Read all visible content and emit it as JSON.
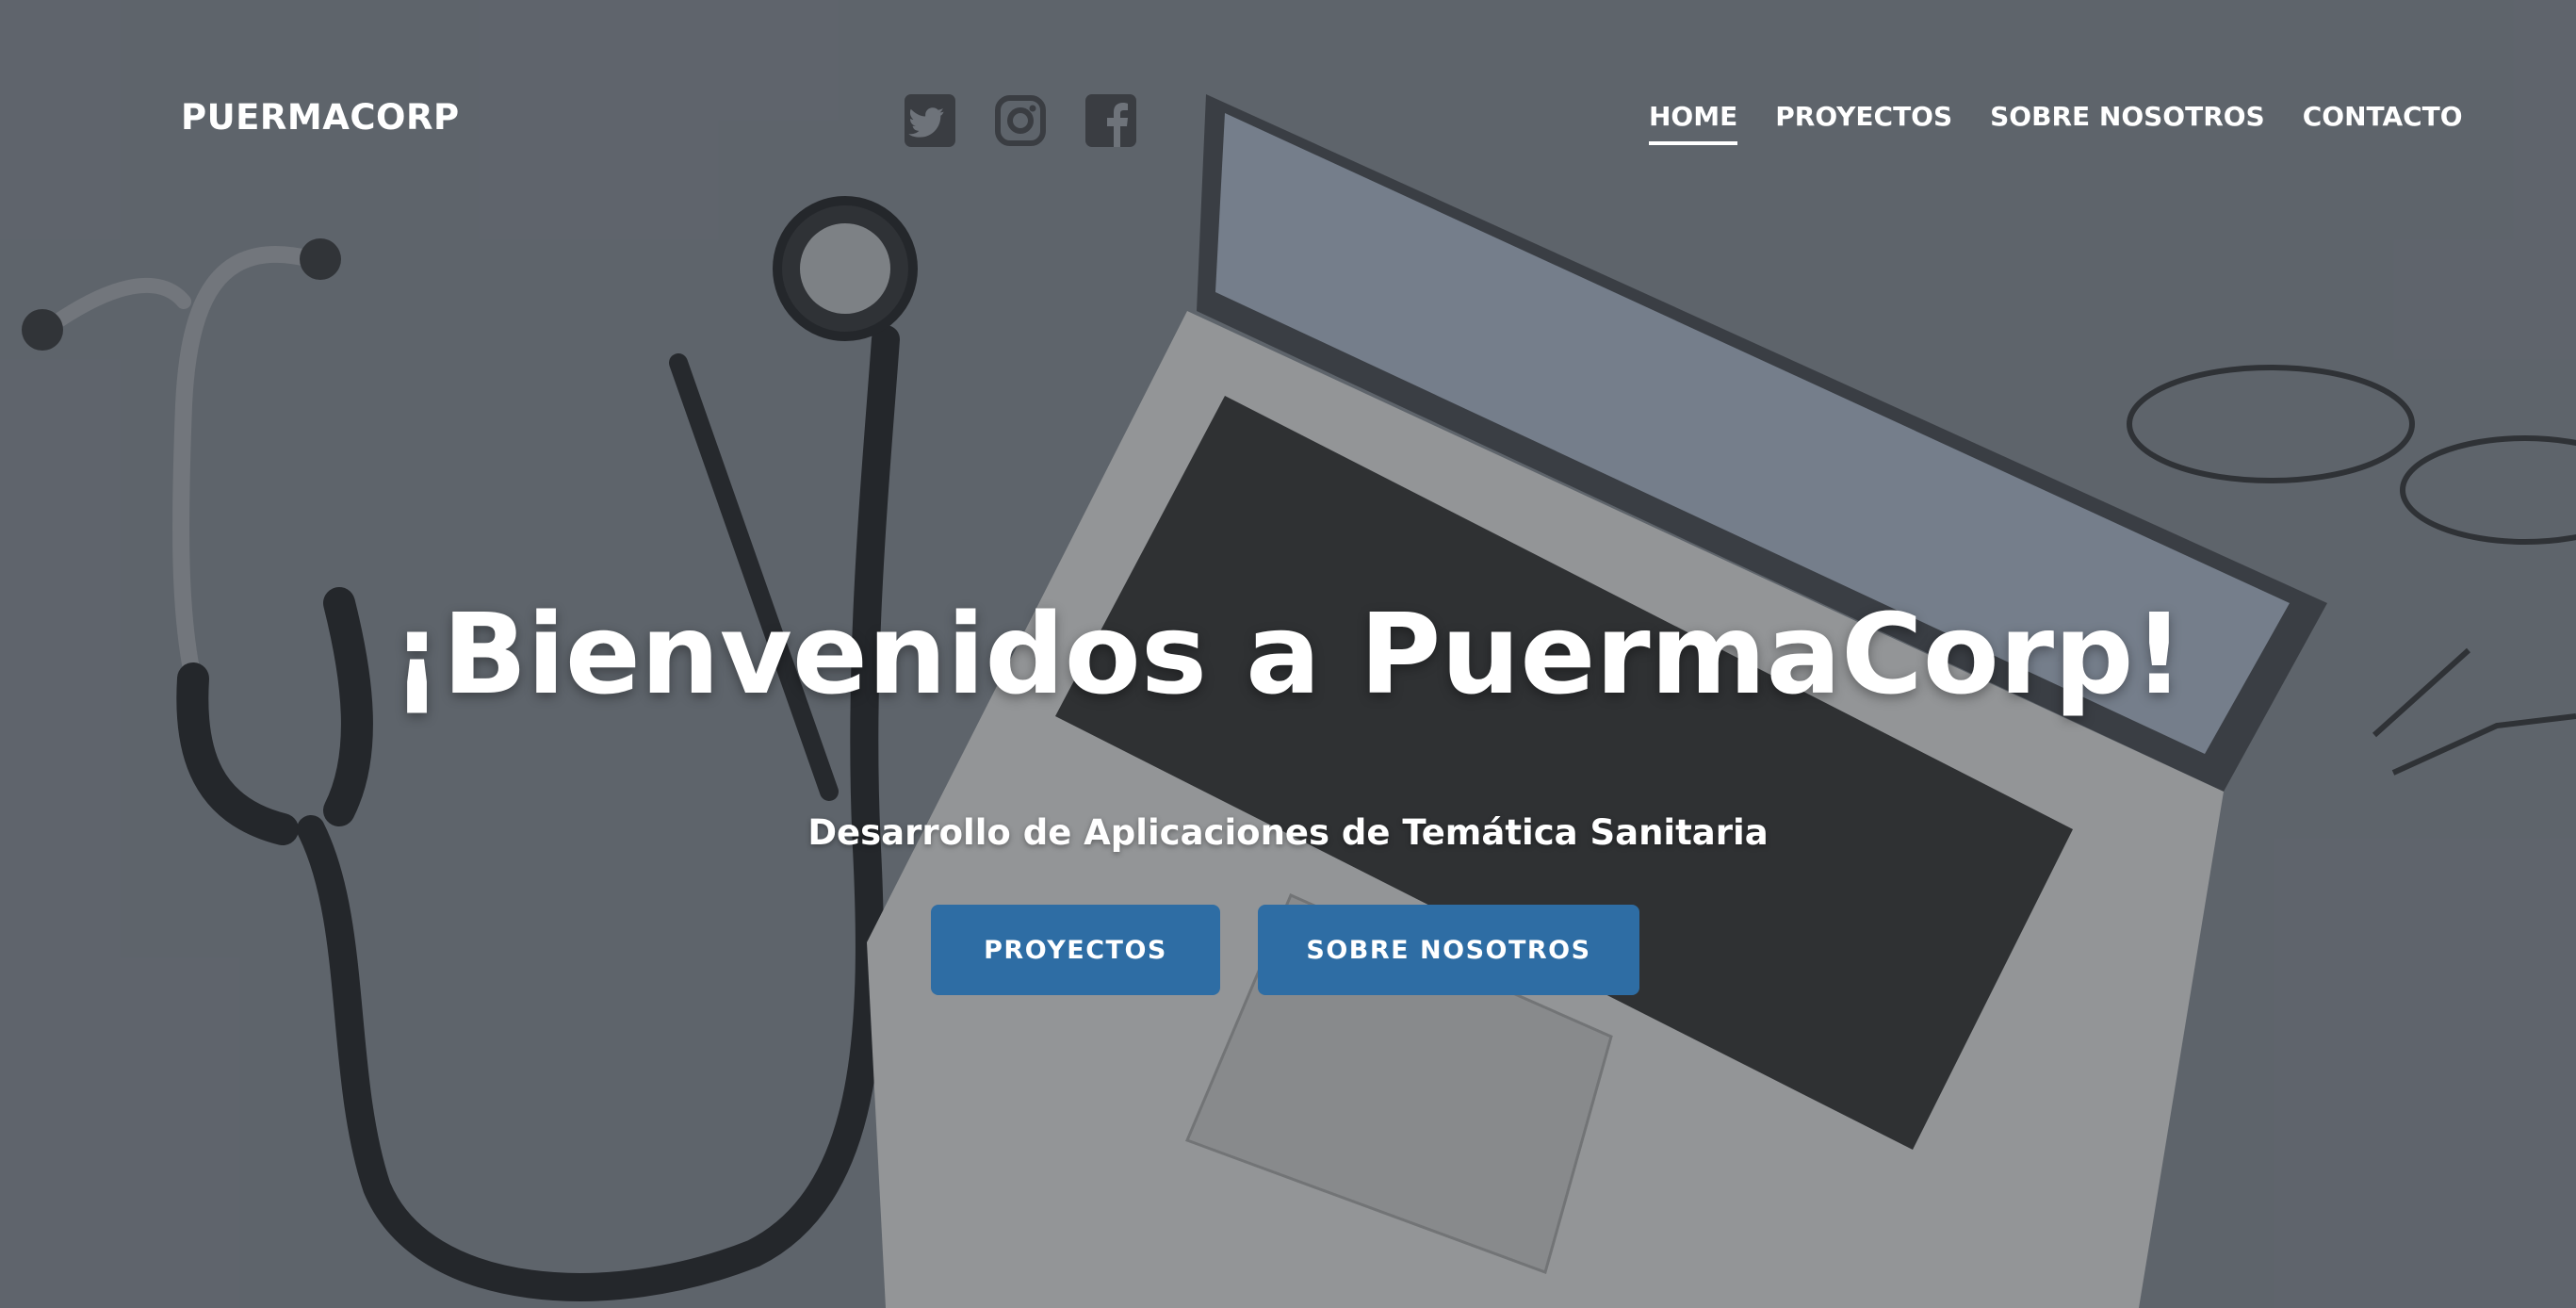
{
  "header": {
    "brand": "PUERMACORP",
    "social": [
      {
        "icon": "twitter-icon"
      },
      {
        "icon": "instagram-icon"
      },
      {
        "icon": "facebook-icon"
      }
    ],
    "nav": [
      {
        "label": "HOME",
        "active": true
      },
      {
        "label": "PROYECTOS",
        "active": false
      },
      {
        "label": "SOBRE NOSOTROS",
        "active": false
      },
      {
        "label": "CONTACTO",
        "active": false
      }
    ]
  },
  "hero": {
    "title": "¡Bienvenidos a PuermaCorp!",
    "subtitle": "Desarrollo de Aplicaciones de Temática Sanitaria",
    "buttons": [
      {
        "label": "PROYECTOS"
      },
      {
        "label": "SOBRE NOSOTROS"
      }
    ],
    "background_image": "stethoscope-laptop-pen-glasses"
  },
  "colors": {
    "background": "#6b7077",
    "button": "#2e6da4",
    "text": "#ffffff",
    "social_icon": "#3a3d42"
  }
}
